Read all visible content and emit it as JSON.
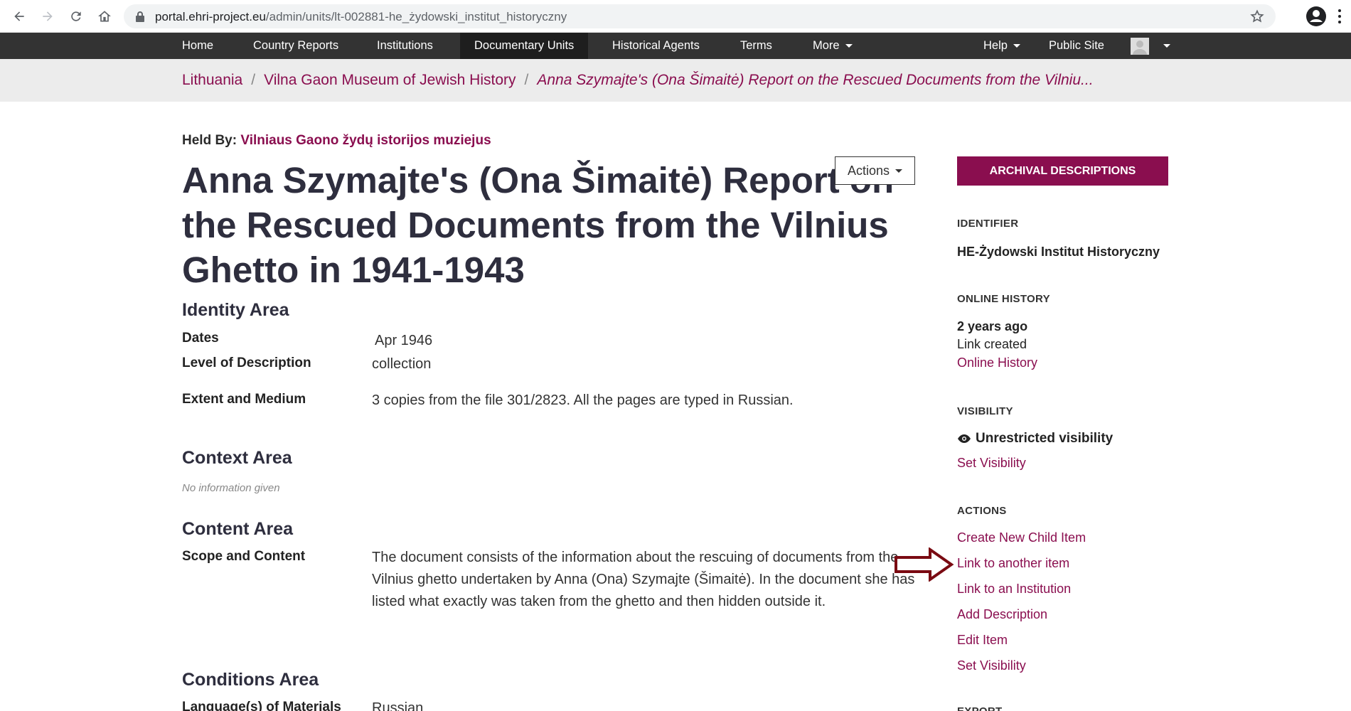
{
  "browser": {
    "url_host": "portal.ehri-project.eu",
    "url_path": "/admin/units/lt-002881-he_żydowski_institut_historyczny"
  },
  "topnav": {
    "home": "Home",
    "country_reports": "Country Reports",
    "institutions": "Institutions",
    "documentary_units": "Documentary Units",
    "historical_agents": "Historical Agents",
    "terms": "Terms",
    "more": "More",
    "help": "Help",
    "public_site": "Public Site"
  },
  "breadcrumb": {
    "country": "Lithuania",
    "institution": "Vilna Gaon Museum of Jewish History",
    "current": "Anna Szymajte's (Ona Šimaitė) Report on the Rescued Documents from the Vilniu..."
  },
  "main": {
    "held_by_label": "Held By:",
    "held_by_value": "Vilniaus Gaono žydų istorijos muziejus",
    "title": "Anna Szymajte's (Ona Šimaitė) Report on the Rescued Documents from the Vilnius Ghetto in 1941-1943",
    "actions_label": "Actions",
    "identity_area": "Identity Area",
    "dates_label": "Dates",
    "dates_value": "Apr 1946",
    "level_label": "Level of Description",
    "level_value": "collection",
    "extent_label": "Extent and Medium",
    "extent_value": "3 copies from the file 301/2823. All the pages are typed in Russian.",
    "context_area": "Context Area",
    "no_info": "No information given",
    "content_area": "Content Area",
    "scope_label": "Scope and Content",
    "scope_value": "The document consists of the information about the rescuing of documents from the Vilnius ghetto undertaken by Anna (Ona) Szymajte (Šimaitė). In the document she has listed what exactly was taken from the ghetto and then hidden outside it.",
    "conditions_area": "Conditions Area",
    "languages_label": "Language(s) of Materials",
    "languages_value": "Russian"
  },
  "sidebar": {
    "archival_button": "ARCHIVAL DESCRIPTIONS",
    "identifier_h": "IDENTIFIER",
    "identifier_v": "HE-Żydowski Institut Historyczny",
    "online_history_h": "ONLINE HISTORY",
    "history_time": "2 years ago",
    "history_event": "Link created",
    "history_link": "Online History",
    "visibility_h": "VISIBILITY",
    "visibility_v": "Unrestricted visibility",
    "set_visibility": "Set Visibility",
    "actions_h": "ACTIONS",
    "create_child": "Create New Child Item",
    "link_item": "Link to another item",
    "link_institution": "Link to an Institution",
    "add_description": "Add Description",
    "edit_item": "Edit Item",
    "set_visibility_2": "Set Visibility",
    "export_h": "EXPORT"
  },
  "colors": {
    "brand": "#8a0e4f",
    "navbar": "#333333",
    "annotation_arrow": "#7a0a12"
  }
}
